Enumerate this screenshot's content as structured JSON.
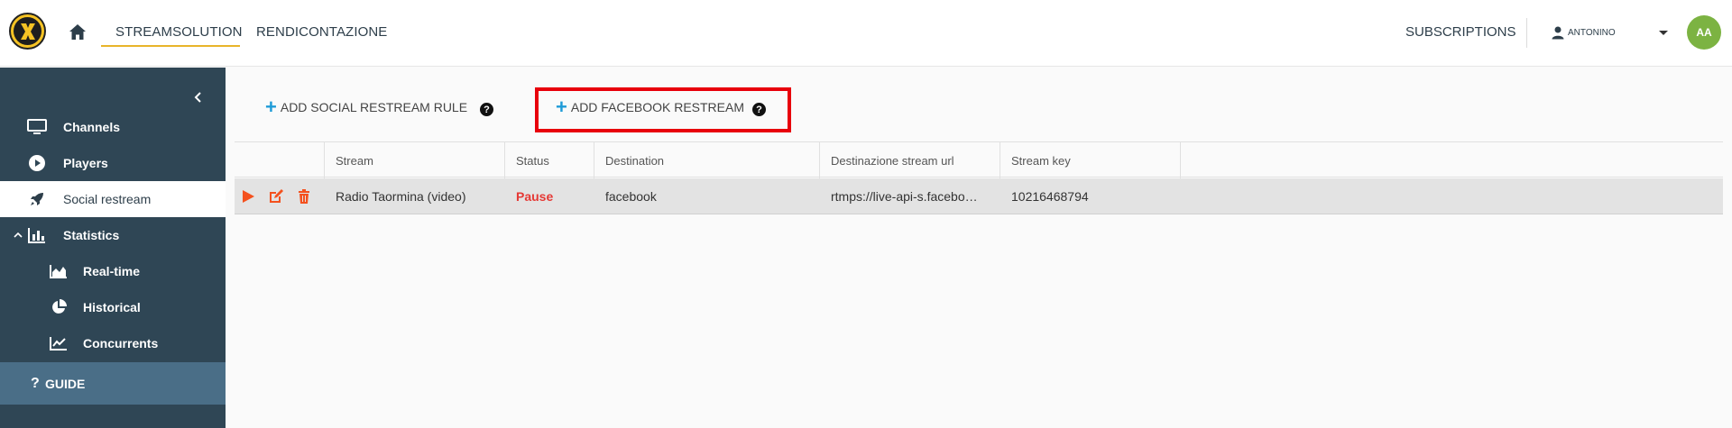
{
  "header": {
    "logo": "streamsolution-logo",
    "tabs": [
      {
        "label": "STREAMSOLUTION",
        "active": true
      },
      {
        "label": "RENDICONTAZIONE",
        "active": false
      }
    ],
    "subscriptions_label": "SUBSCRIPTIONS",
    "user_name": "ANTONINO",
    "avatar_initials": "AA"
  },
  "sidebar": {
    "items": [
      {
        "label": "Channels",
        "icon": "monitor-icon",
        "active": false
      },
      {
        "label": "Players",
        "icon": "play-circle-icon",
        "active": false
      },
      {
        "label": "Social restream",
        "icon": "rocket-icon",
        "active": true
      },
      {
        "label": "Statistics",
        "icon": "bar-chart-icon",
        "active": false,
        "expanded": true
      },
      {
        "label": "Real-time",
        "icon": "area-chart-icon",
        "sub": true
      },
      {
        "label": "Historical",
        "icon": "pie-chart-icon",
        "sub": true
      },
      {
        "label": "Concurrents",
        "icon": "line-chart-icon",
        "sub": true
      }
    ],
    "guide_label": "GUIDE"
  },
  "toolbar": {
    "add_social_rule": "ADD SOCIAL RESTREAM RULE",
    "add_facebook": "ADD FACEBOOK RESTREAM"
  },
  "table": {
    "columns": [
      "Stream",
      "Status",
      "Destination",
      "Destinazione stream url",
      "Stream key"
    ],
    "rows": [
      {
        "stream": "Radio Taormina (video)",
        "status": "Pause",
        "destination": "facebook",
        "url": "rtmps://live-api-s.facebo…",
        "key": "10216468794"
      }
    ]
  },
  "colors": {
    "sidebar_bg": "#2f4655",
    "accent_blue": "#1e9bd7",
    "action_orange": "#f4511e",
    "status_red": "#e53935",
    "highlight_red": "#e8000b",
    "underline_gold": "#e8b42a",
    "avatar_green": "#7cb342"
  }
}
